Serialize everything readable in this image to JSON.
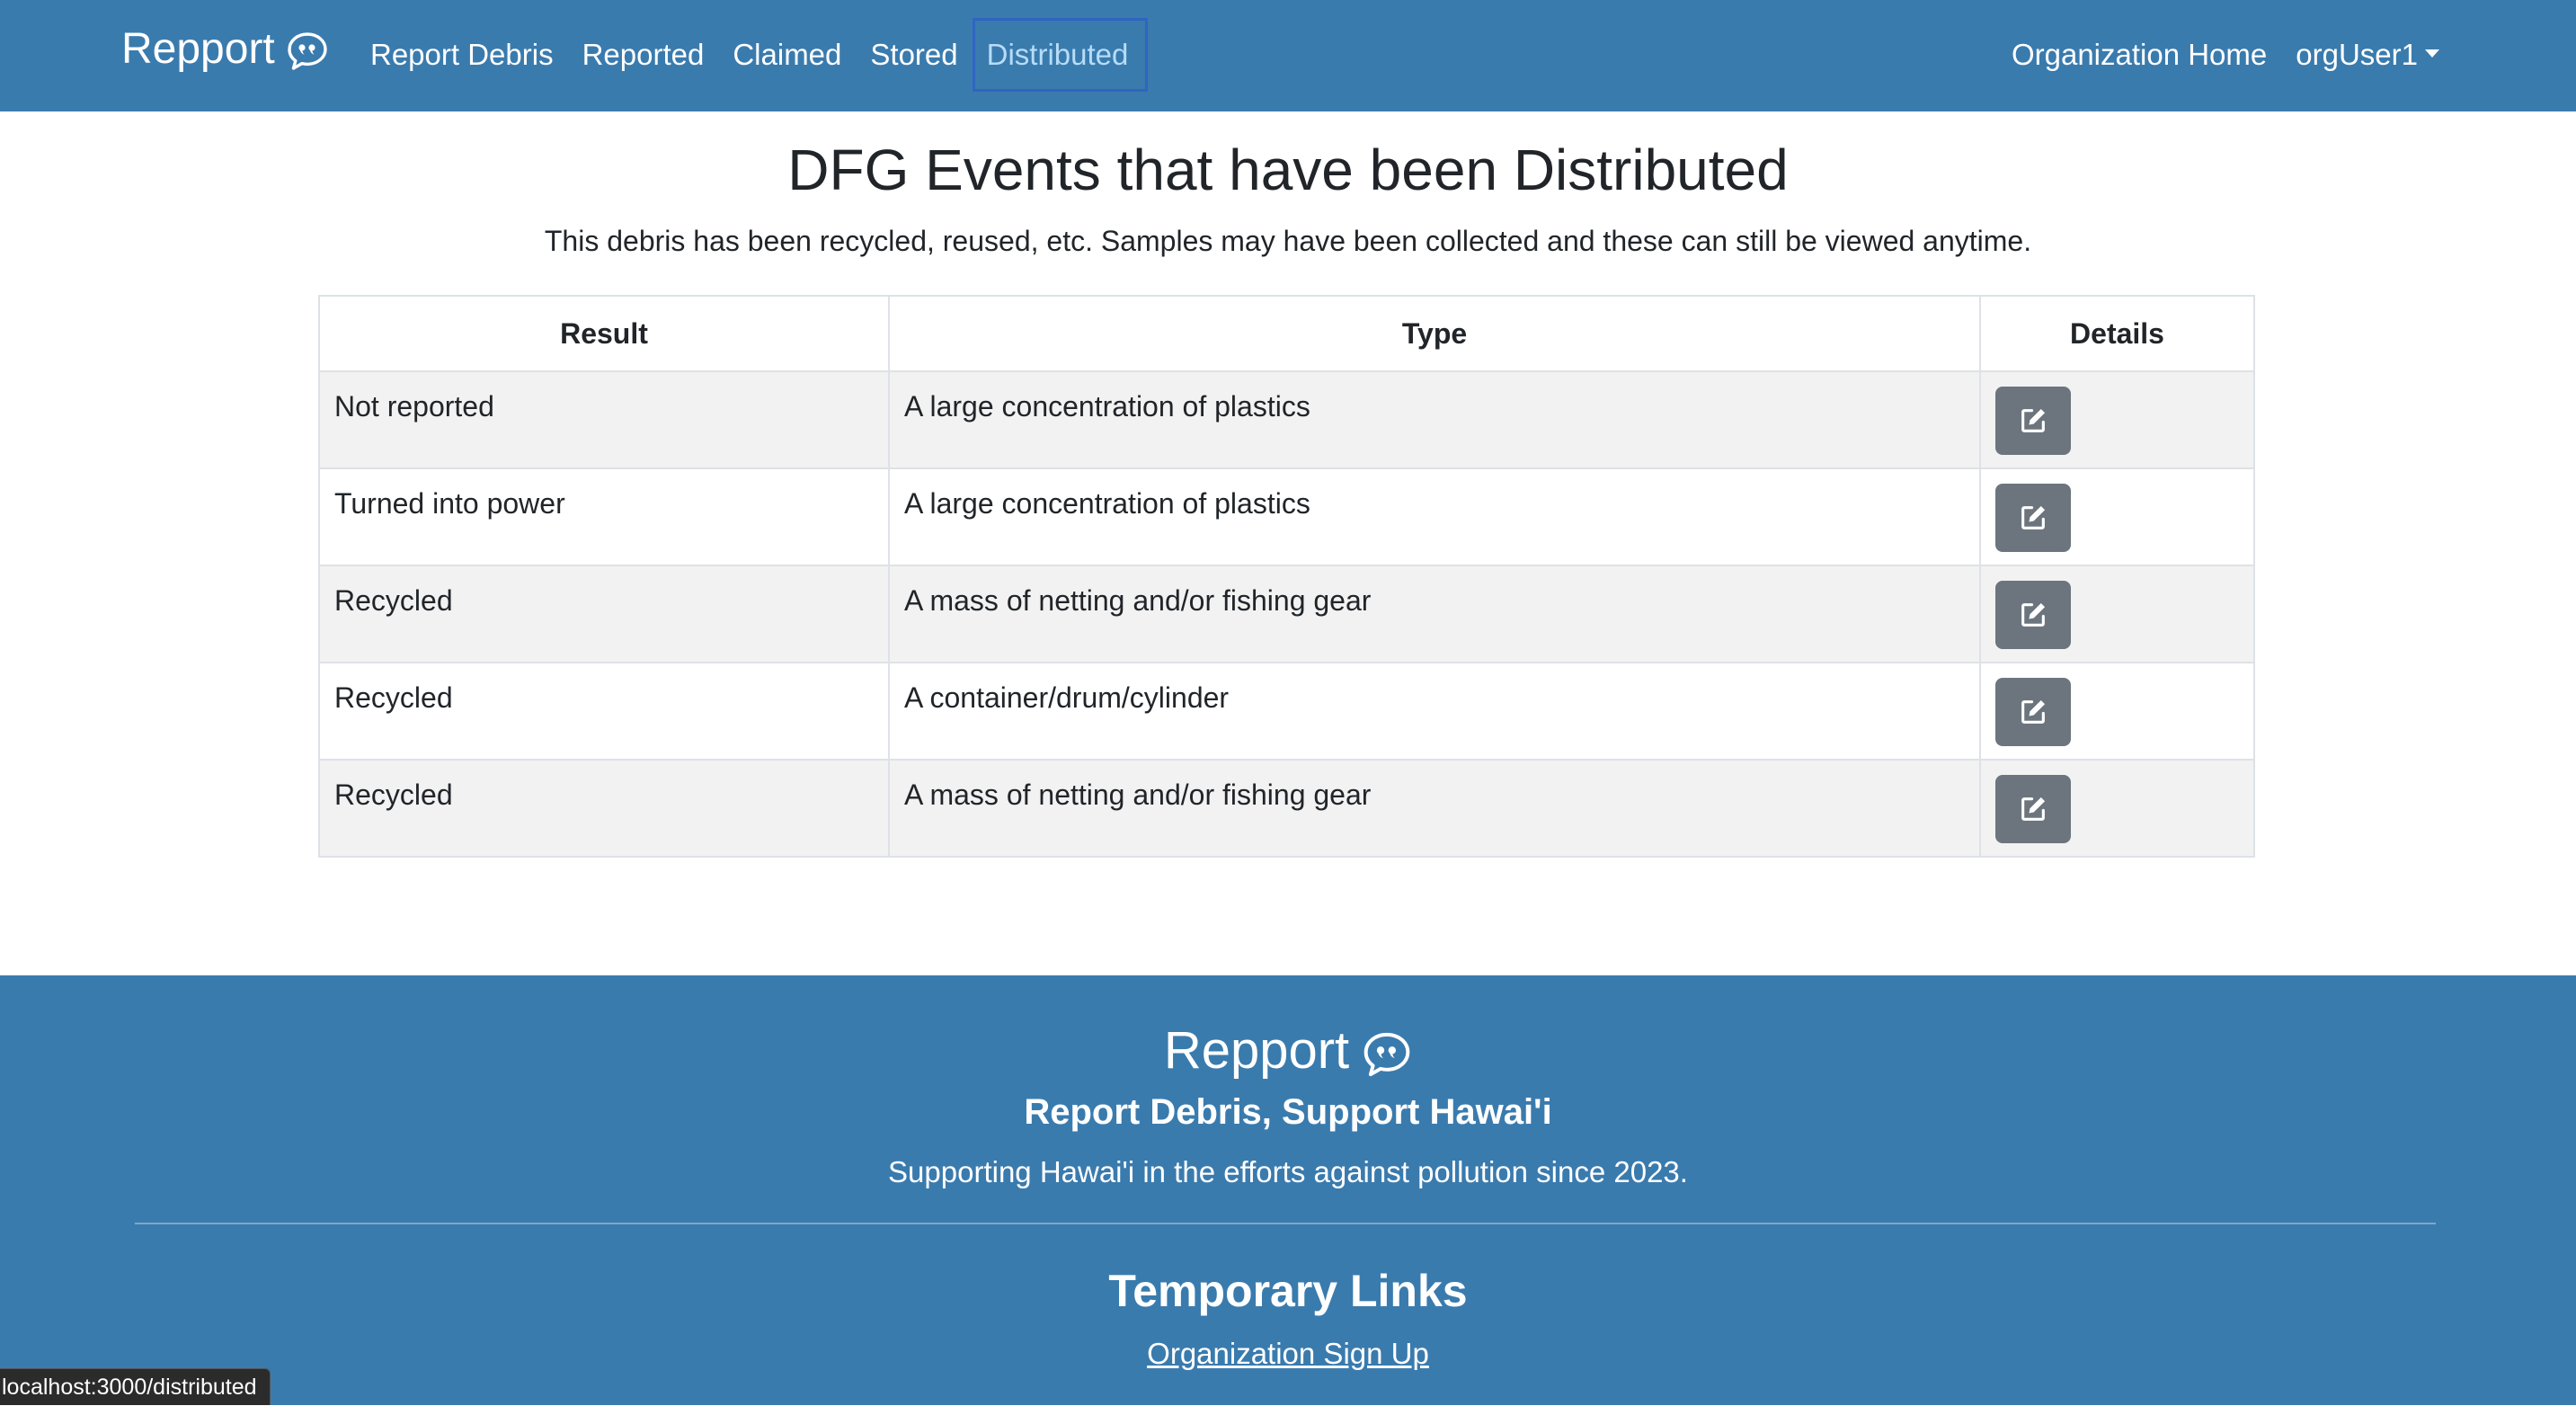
{
  "navbar": {
    "brand": "Repport",
    "brand_icon": "speech-bubble-quote-icon",
    "links": [
      {
        "label": "Report Debris",
        "active": false
      },
      {
        "label": "Reported",
        "active": false
      },
      {
        "label": "Claimed",
        "active": false
      },
      {
        "label": "Stored",
        "active": false
      },
      {
        "label": "Distributed",
        "active": true
      }
    ],
    "org_home": "Organization Home",
    "user": "orgUser1"
  },
  "main": {
    "title": "DFG Events that have been Distributed",
    "subtitle": "This debris has been recycled, reused, etc. Samples may have been collected and these can still be viewed anytime.",
    "table": {
      "headers": {
        "result": "Result",
        "type": "Type",
        "details": "Details"
      },
      "rows": [
        {
          "result": "Not reported",
          "type": "A large concentration of plastics",
          "details_icon": "edit-icon"
        },
        {
          "result": "Turned into power",
          "type": "A large concentration of plastics",
          "details_icon": "edit-icon"
        },
        {
          "result": "Recycled",
          "type": "A mass of netting and/or fishing gear",
          "details_icon": "edit-icon"
        },
        {
          "result": "Recycled",
          "type": "A container/drum/cylinder",
          "details_icon": "edit-icon"
        },
        {
          "result": "Recycled",
          "type": "A mass of netting and/or fishing gear",
          "details_icon": "edit-icon"
        }
      ]
    }
  },
  "footer": {
    "brand": "Repport",
    "tagline": "Report Debris, Support Hawai'i",
    "since": "Supporting Hawai'i in the efforts against pollution since 2023.",
    "links_title": "Temporary Links",
    "links": [
      {
        "label": "Organization Sign Up"
      }
    ]
  },
  "status_bar": {
    "url": "localhost:3000/distributed"
  },
  "colors": {
    "primary": "#3a7bae",
    "active_link": "#b6dcf7",
    "button": "#6c757d",
    "stripe": "#f2f2f2"
  }
}
